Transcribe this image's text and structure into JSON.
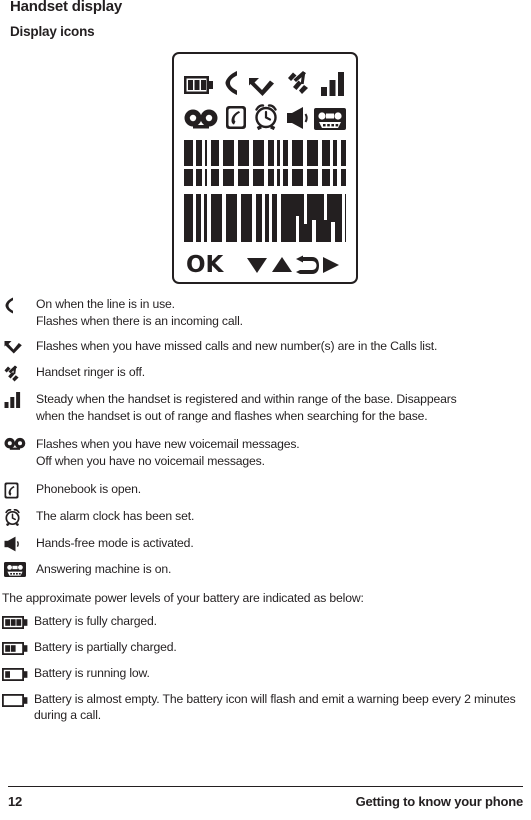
{
  "page": {
    "title": "Handset display",
    "subtitle": "Display icons"
  },
  "lcd": {
    "row1_icons": [
      "battery-icon",
      "line-in-use-icon",
      "missed-call-icon",
      "ringer-off-icon",
      "signal-bars-icon"
    ],
    "row2_icons": [
      "voicemail-icon",
      "phonebook-icon",
      "alarm-clock-icon",
      "speaker-icon",
      "answering-machine-icon"
    ],
    "softkey_ok": "OK",
    "softkey_arrows": [
      "down-triangle-icon",
      "up-triangle-icon",
      "back-arrow-icon",
      "right-triangle-icon"
    ]
  },
  "legend": [
    {
      "icon": "line-in-use-icon",
      "line1": "On when the line is in use.",
      "line2": "Flashes when there is an incoming call."
    },
    {
      "icon": "missed-call-icon",
      "line1": "Flashes when you have missed calls and new number(s) are in the Calls list.",
      "line2": ""
    },
    {
      "icon": "ringer-off-icon",
      "line1": "Handset ringer is off.",
      "line2": ""
    },
    {
      "icon": "signal-bars-icon",
      "line1": "Steady when the handset is registered and within range of the base. Disappears",
      "line2": "when the handset is out of range and flashes when searching for the base."
    },
    {
      "icon": "voicemail-icon",
      "line1": "Flashes when you have new voicemail messages.",
      "line2": "Off when you have no voicemail messages."
    },
    {
      "icon": "phonebook-icon",
      "line1": "Phonebook is open.",
      "line2": ""
    },
    {
      "icon": "alarm-clock-icon",
      "line1": "The alarm clock has been set.",
      "line2": ""
    },
    {
      "icon": "speaker-icon",
      "line1": "Hands-free mode is activated.",
      "line2": ""
    },
    {
      "icon": "answering-machine-icon",
      "line1": "Answering machine is on.",
      "line2": ""
    }
  ],
  "battery": {
    "intro": "The approximate power levels of your battery are indicated as below:",
    "levels": [
      {
        "icon": "battery-full-icon",
        "bars": 3,
        "text": "Battery is fully charged."
      },
      {
        "icon": "battery-partial-icon",
        "bars": 2,
        "text": "Battery is partially charged."
      },
      {
        "icon": "battery-low-icon",
        "bars": 1,
        "text": "Battery is running low."
      },
      {
        "icon": "battery-empty-icon",
        "bars": 0,
        "line1": "Battery is almost empty. The battery icon will flash and emit a warning beep every 2",
        "line2": "minutes during a call."
      }
    ]
  },
  "footer": {
    "page_number": "12",
    "section": "Getting to know your phone"
  },
  "colors": {
    "ink": "#231f20",
    "paper": "#ffffff"
  }
}
